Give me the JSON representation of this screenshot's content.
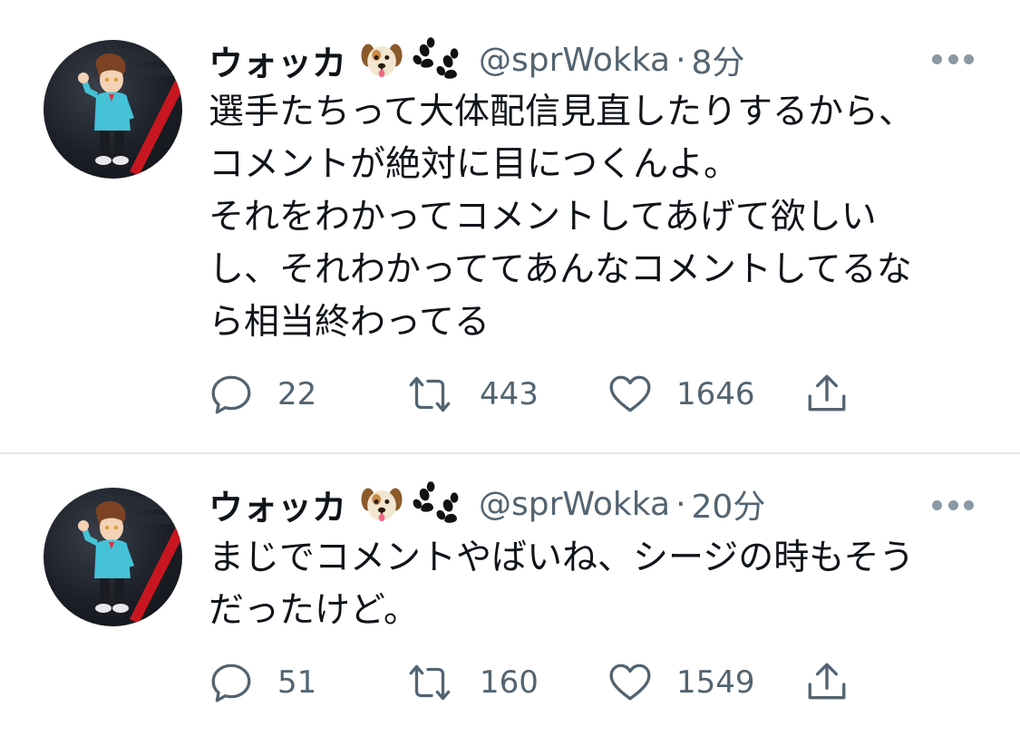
{
  "tweets": [
    {
      "author": {
        "name": "ウォッカ",
        "handle": "@sprWokka",
        "badges": [
          "dog-face-emoji",
          "paw-prints-emoji"
        ]
      },
      "separator": "·",
      "time": "8分",
      "text_lines": [
        "選手たちって大体配信見直したりするから、",
        "コメントが絶対に目につくんよ。",
        "それをわかってコメントしてあげて欲しい",
        "し、それわかっててあんなコメントしてるな",
        "ら相当終わってる"
      ],
      "counts": {
        "replies": "22",
        "retweets": "443",
        "likes": "1646"
      }
    },
    {
      "author": {
        "name": "ウォッカ",
        "handle": "@sprWokka",
        "badges": [
          "dog-face-emoji",
          "paw-prints-emoji"
        ]
      },
      "separator": "·",
      "time": "20分",
      "text_lines": [
        "まじでコメントやばいね、シージの時もそう",
        "だったけど。"
      ],
      "counts": {
        "replies": "51",
        "retweets": "160",
        "likes": "1549"
      }
    }
  ],
  "colors": {
    "text": "#0f1419",
    "secondary": "#536471",
    "icon": "#536471",
    "divider": "#e6e9eb"
  }
}
